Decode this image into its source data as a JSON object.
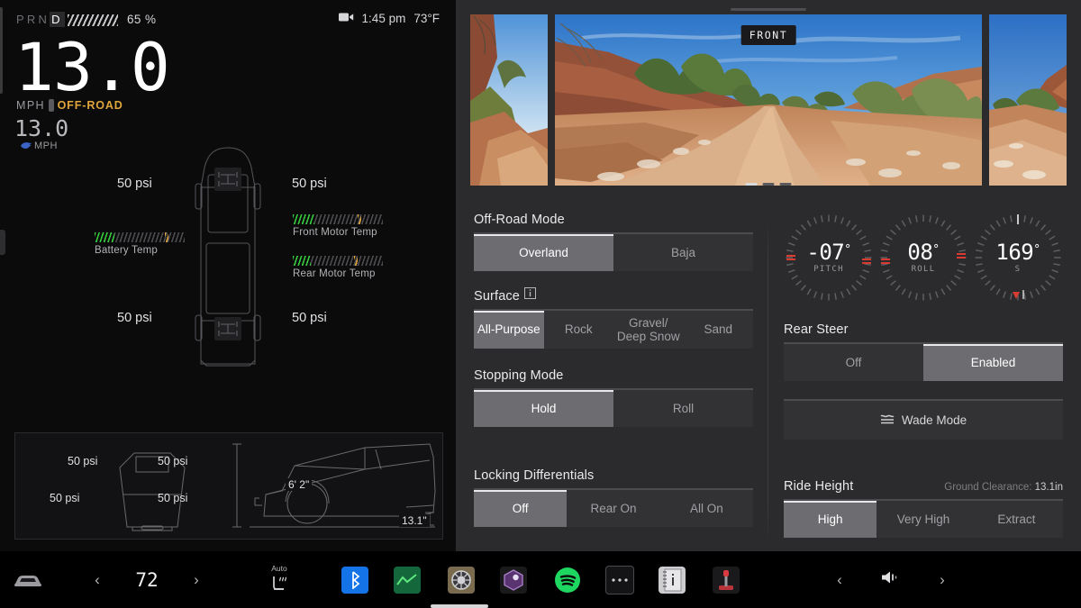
{
  "cluster": {
    "status": {
      "gear_options": [
        "P",
        "R",
        "N",
        "D"
      ],
      "gear_selected": "D",
      "battery_percent": "65 %",
      "battery_fill": 65,
      "dashcam_icon": "dashcam-icon",
      "time": "1:45 pm",
      "outside_temp": "73°F"
    },
    "speed": {
      "value": "13.0",
      "units": "MPH",
      "separator": "·",
      "mode": "OFF-ROAD",
      "set_speed": "13.0",
      "set_speed_units": "MPH",
      "autopilot_icon": "autopilot-icon"
    },
    "tires": {
      "front_left": "50 psi",
      "front_right": "50 psi",
      "rear_left": "50 psi",
      "rear_right": "50 psi"
    },
    "temps": [
      {
        "label": "Battery Temp",
        "fill": 22,
        "mark": 78
      },
      {
        "label": "Front Motor Temp",
        "fill": 24,
        "mark": 72
      },
      {
        "label": "Rear Motor Temp",
        "fill": 20,
        "mark": 68
      }
    ],
    "ride_panel": {
      "tires": {
        "front_left": "50 psi",
        "front_right": "50 psi",
        "rear_left": "50 psi",
        "rear_right": "50 psi"
      },
      "height_label": "6' 2\"",
      "clearance_label": "13.1\""
    }
  },
  "cameras": {
    "active_label": "FRONT",
    "dots": 3,
    "active_dot": 0,
    "views": [
      "left-camera-thumbnail",
      "front-camera-main",
      "right-camera-thumbnail"
    ]
  },
  "controls": {
    "offroad_mode": {
      "title": "Off-Road Mode",
      "options": [
        "Overland",
        "Baja"
      ],
      "selected": "Overland"
    },
    "surface": {
      "title": "Surface",
      "info_icon": "info-icon",
      "options": [
        "All-Purpose",
        "Rock",
        "Gravel/\nDeep Snow",
        "Sand"
      ],
      "selected": "All-Purpose"
    },
    "stopping_mode": {
      "title": "Stopping Mode",
      "options": [
        "Hold",
        "Roll"
      ],
      "selected": "Hold"
    },
    "locking_differentials": {
      "title": "Locking Differentials",
      "options": [
        "Off",
        "Rear On",
        "All On"
      ],
      "selected": "Off"
    },
    "rear_steer": {
      "title": "Rear Steer",
      "options": [
        "Off",
        "Enabled"
      ],
      "selected": "Enabled"
    },
    "wade_mode": {
      "label": "Wade Mode",
      "icon": "water-wave-icon"
    },
    "ride_height": {
      "title": "Ride Height",
      "clearance_prefix": "Ground Clearance:",
      "clearance_value": "13.1in",
      "options": [
        "High",
        "Very High",
        "Extract"
      ],
      "selected": "High"
    }
  },
  "gauges": [
    {
      "name": "pitch",
      "value": "-07",
      "degree": "°",
      "label": "PITCH",
      "needle_deg": -7
    },
    {
      "name": "roll",
      "value": "08",
      "degree": "°",
      "label": "ROLL",
      "needle_deg": 8
    },
    {
      "name": "heading",
      "value": "169",
      "degree": "°",
      "label": "S",
      "needle_deg": 169
    }
  ],
  "taskbar": {
    "car_icon": "car-icon",
    "temp_prev_icon": "chevron-left-icon",
    "temp_value": "72",
    "temp_next_icon": "chevron-right-icon",
    "seat_auto_label": "Auto",
    "seat_icon": "seat-heater-icon",
    "apps": [
      {
        "name": "bluetooth-app-icon",
        "color": "#1473e6"
      },
      {
        "name": "energy-app-icon",
        "color": "#17703a"
      },
      {
        "name": "tire-app-icon",
        "color": "#7b6a4f"
      },
      {
        "name": "theater-app-icon",
        "color": "#5a3470"
      },
      {
        "name": "spotify-app-icon",
        "color": "#1ed760"
      },
      {
        "name": "more-apps-icon",
        "color": "#1a1a1c"
      },
      {
        "name": "owners-manual-icon",
        "color": "#cdcdd0"
      },
      {
        "name": "arcade-app-icon",
        "color": "#b8343a"
      }
    ],
    "media_prev_icon": "chevron-left-icon",
    "volume_icon": "volume-icon",
    "media_next_icon": "chevron-right-icon"
  },
  "colors": {
    "offroad_accent": "#e0a63c",
    "temp_green": "#35c93d",
    "selected_bg": "#6d6d71",
    "panel_bg": "#2b2b2d",
    "cluster_bg": "#0b0b0c"
  }
}
